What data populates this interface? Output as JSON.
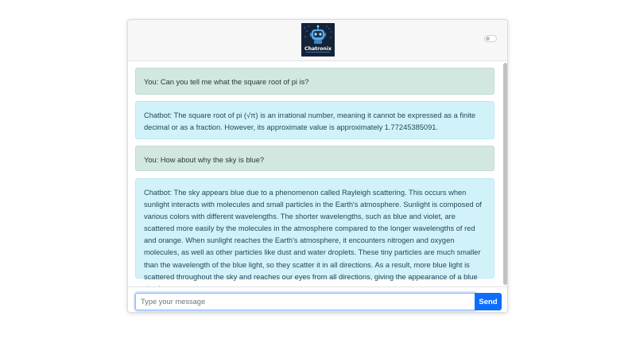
{
  "header": {
    "logo_text": "Chatronix",
    "theme_toggle_on": false
  },
  "messages": [
    {
      "role": "user",
      "text": "You: Can you tell me what the square root of pi is?"
    },
    {
      "role": "bot",
      "text": "Chatbot: The square root of pi (√π) is an irrational number, meaning it cannot be expressed as a finite decimal or as a fraction. However, its approximate value is approximately 1.77245385091."
    },
    {
      "role": "user",
      "text": "You: How about why the sky is blue?"
    },
    {
      "role": "bot",
      "text": "Chatbot: The sky appears blue due to a phenomenon called Rayleigh scattering. This occurs when sunlight interacts with molecules and small particles in the Earth's atmosphere. Sunlight is composed of various colors with different wavelengths. The shorter wavelengths, such as blue and violet, are scattered more easily by the molecules in the atmosphere compared to the longer wavelengths of red and orange. When sunlight reaches the Earth's atmosphere, it encounters nitrogen and oxygen molecules, as well as other particles like dust and water droplets. These tiny particles are much smaller than the wavelength of the blue light, so they scatter it in all directions. As a result, more blue light is scattered throughout the sky and reaches our eyes from all directions, giving the appearance of a blue sky. In contrast,"
    }
  ],
  "composer": {
    "placeholder": "Type your message",
    "value": "",
    "send_label": "Send"
  },
  "colors": {
    "user_bubble": "#d2e7df",
    "bot_bubble": "#d2f2fa",
    "send_button": "#0d6efd"
  }
}
